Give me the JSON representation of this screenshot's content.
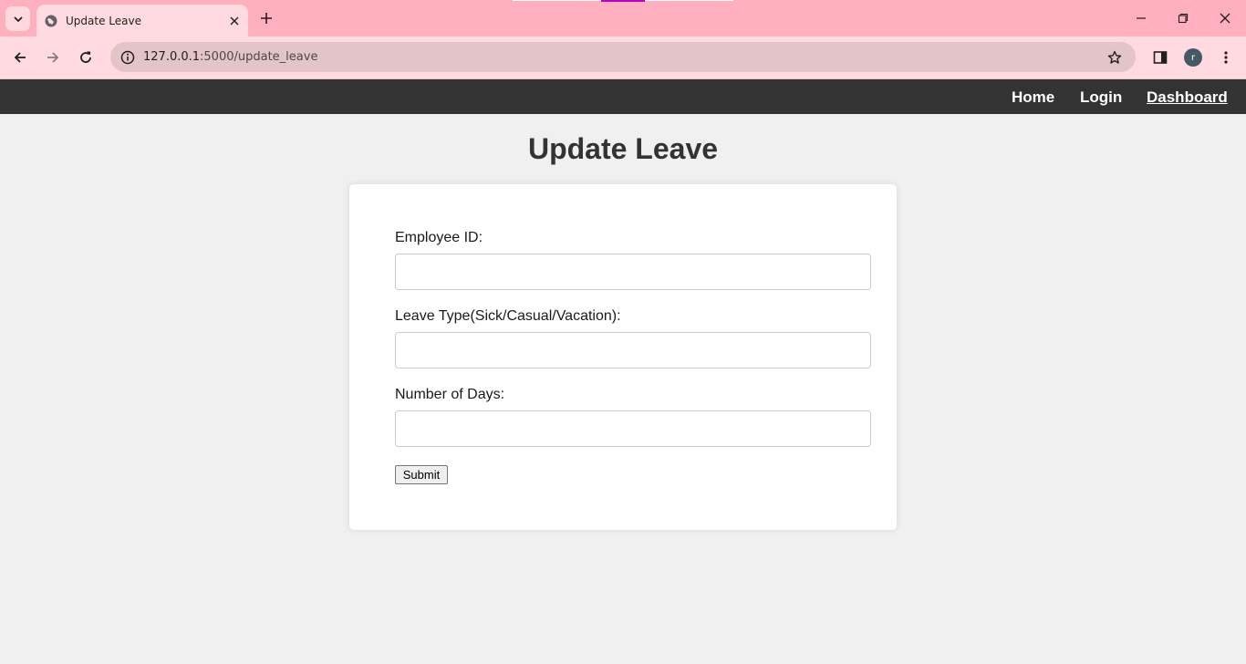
{
  "browser": {
    "tab_title": "Update Leave",
    "url_host": "127.0.0.1",
    "url_path": ":5000/update_leave",
    "profile_initial": "r",
    "icons": [
      "tab-search-icon",
      "globe-icon",
      "close-icon",
      "plus-icon",
      "minimize-icon",
      "restore-icon",
      "window-close-icon",
      "back-arrow-icon",
      "forward-arrow-icon",
      "reload-icon",
      "info-icon",
      "star-icon",
      "side-panel-icon",
      "kebab-menu-icon"
    ],
    "colors": {
      "tabstrip": "#ffafbd",
      "toolbar": "#ffdbe1",
      "omnibox": "#e3c4c9"
    }
  },
  "navbar": {
    "links": [
      {
        "label": "Home"
      },
      {
        "label": "Login"
      },
      {
        "label": "Dashboard"
      }
    ],
    "background": "#333333"
  },
  "page": {
    "title": "Update Leave"
  },
  "form": {
    "employee_id": {
      "label": "Employee ID:",
      "value": ""
    },
    "leave_type": {
      "label": "Leave Type(Sick/Casual/Vacation):",
      "value": ""
    },
    "days": {
      "label": "Number of Days:",
      "value": ""
    },
    "submit_label": "Submit"
  }
}
